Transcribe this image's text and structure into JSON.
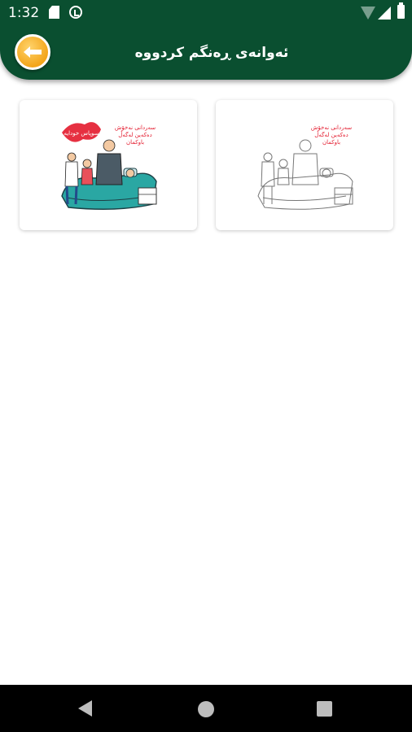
{
  "status_bar": {
    "time": "1:32",
    "icons": [
      "sd-card-icon",
      "sync-icon",
      "wifi-icon",
      "signal-icon",
      "battery-icon"
    ]
  },
  "app_bar": {
    "title": "ئەوانەی ڕەنگم کردووە",
    "back_icon": "arrow-left-icon",
    "color": "#0a4f30",
    "accent": "#f3a51a"
  },
  "gallery": {
    "items": [
      {
        "kind": "colored",
        "caption_lines": [
          "سەردانی نەخۆش",
          "دەکەین لەگەڵ",
          "باوکمان"
        ],
        "overlay_text": "سوپاس خودایە"
      },
      {
        "kind": "outline",
        "caption_lines": [
          "سەردانی نەخۆش",
          "دەکەین لەگەڵ",
          "باوکمان"
        ]
      }
    ]
  },
  "nav_bar": {
    "icons": [
      "nav-back-icon",
      "nav-home-icon",
      "nav-recents-icon"
    ]
  }
}
